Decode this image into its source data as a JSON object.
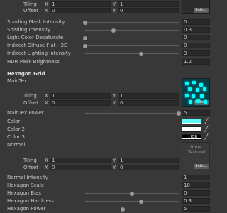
{
  "top_tiling": {
    "label": "Tiling",
    "x_axis": "X",
    "x": "1",
    "y_axis": "Y",
    "y": "1"
  },
  "top_offset": {
    "label": "Offset",
    "x_axis": "X",
    "x": "0",
    "y_axis": "Y",
    "y": "0"
  },
  "top_select": "Select",
  "props": {
    "shading_mask_intensity": {
      "label": "Shading Mask Intensity",
      "value": "0",
      "fraction": 0.0
    },
    "shading_intensity": {
      "label": "Shading Intensity",
      "value": "0.3",
      "fraction": 0.3
    },
    "light_color_desaturate": {
      "label": "Light Color Desaturate",
      "value": "0",
      "fraction": 0.0
    },
    "indirect_diffuse_flat": {
      "label": "Indirect Diffuse Flat - 3D",
      "value": "0",
      "fraction": 0.0
    },
    "indirect_lighting_intensity": {
      "label": "Indirect Lighting Intensity",
      "value": "3",
      "fraction": 0.6
    },
    "hdr_peak_brightness": {
      "label": "HDR Peak Brightness",
      "value": "1.2"
    }
  },
  "hex_section": {
    "title": "Hexagon Grid",
    "maintex": {
      "label": "MainTex",
      "select": "Select",
      "tiling": {
        "label": "Tiling",
        "x_axis": "X",
        "x": "1",
        "y_axis": "Y",
        "y": "1"
      },
      "offset": {
        "label": "Offset",
        "x_axis": "X",
        "x": "0",
        "y_axis": "Y",
        "y": "0"
      }
    },
    "maintex_power": {
      "label": "MainTex Power",
      "value": "5",
      "fraction": 1.0
    },
    "color": {
      "label": "Color",
      "hex": "#5ff8f8"
    },
    "color2": {
      "label": "Color 2",
      "hex": "#ffffff"
    },
    "color3": {
      "label": "Color 3",
      "hex": "#000000",
      "badge": "HDR"
    },
    "normal": {
      "label": "Normal",
      "none_line1": "None",
      "none_line2": "(Texture)",
      "select": "Select",
      "tiling": {
        "label": "Tiling",
        "x_axis": "X",
        "x": "1",
        "y_axis": "Y",
        "y": "1"
      },
      "offset": {
        "label": "Offset",
        "x_axis": "X",
        "x": "0",
        "y_axis": "Y",
        "y": "0"
      }
    },
    "normal_intensity": {
      "label": "Normal Intensity",
      "value": "1"
    },
    "hexagon_scale": {
      "label": "Hexagon Scale",
      "value": "18"
    },
    "hexagon_bias": {
      "label": "Hexagon Bias",
      "value": "0",
      "fraction": 0.5
    },
    "hexagon_hardness": {
      "label": "Hexagon Hardness",
      "value": "0.3",
      "fraction": 0.6
    },
    "hexagon_power": {
      "label": "Hexagon Power",
      "value": "5",
      "fraction": 0.4
    }
  },
  "colors": {
    "accent_cyan": "#00ffff",
    "panel_bg": "#383838",
    "field_bg": "#2a2a2a"
  },
  "icons": {
    "eyedropper": "eyedropper-icon"
  }
}
